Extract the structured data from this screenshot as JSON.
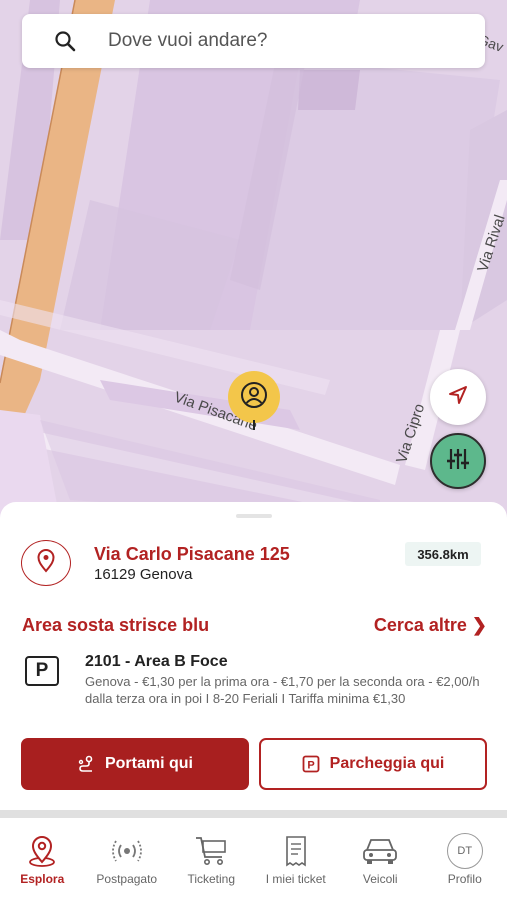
{
  "map": {
    "street_labels": [
      "Via Pisacane",
      "Via Cipro",
      "Via Rival",
      "Gav"
    ]
  },
  "search": {
    "placeholder": "Dove vuoi andare?"
  },
  "sheet": {
    "address_line1": "Via Carlo Pisacane 125",
    "address_line2": "16129 Genova",
    "distance": "356.8km",
    "area_title": "Area sosta strisce blu",
    "search_more": "Cerca altre ❯",
    "parking_icon": "P",
    "zone_title": "2101 - Area B Foce",
    "zone_description": "Genova - €1,30 per la prima ora - €1,70 per la seconda ora - €2,00/h dalla terza ora in poi I 8-20 Feriali I Tariffa minima €1,30",
    "primary_button": "Portami qui",
    "secondary_button": "Parcheggia qui"
  },
  "tabbar": {
    "items": [
      {
        "label": "Esplora",
        "icon": "map-pin-icon",
        "active": true
      },
      {
        "label": "Postpagato",
        "icon": "broadcast-icon",
        "active": false
      },
      {
        "label": "Ticketing",
        "icon": "cart-icon",
        "active": false
      },
      {
        "label": "I miei ticket",
        "icon": "receipt-icon",
        "active": false
      },
      {
        "label": "Veicoli",
        "icon": "car-icon",
        "active": false
      },
      {
        "label": "Profilo",
        "icon": "avatar-icon",
        "active": false,
        "initials": "DT"
      }
    ]
  },
  "colors": {
    "accent": "#b22222",
    "map_bg": "#e3d3e8",
    "filter_fab": "#5db88c",
    "pin": "#f3c64a"
  }
}
